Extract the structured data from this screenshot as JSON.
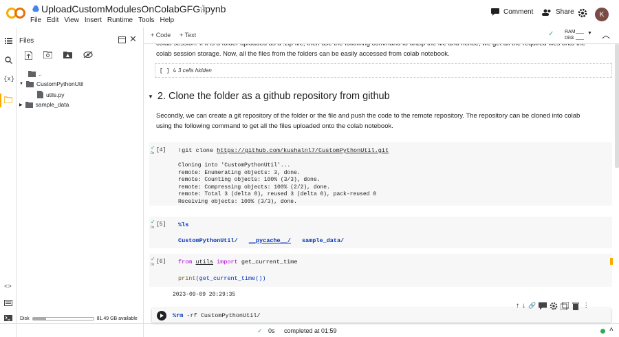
{
  "app": {
    "notebook_title": "UploadCustomModulesOnColabGFG.ipynb",
    "logo_text": "CO",
    "menu": [
      "File",
      "Edit",
      "View",
      "Insert",
      "Runtime",
      "Tools",
      "Help"
    ],
    "comment_label": "Comment",
    "share_label": "Share",
    "avatar_initial": "K",
    "add_code_label": "+ Code",
    "add_text_label": "+ Text",
    "ram_label": "RAM",
    "disk_label": "Disk"
  },
  "sidebar": {
    "files_title": "Files",
    "tree": [
      {
        "name": ".."
      },
      {
        "name": "CustomPythonUtil"
      },
      {
        "name": "utils.py"
      },
      {
        "name": "sample_data"
      }
    ],
    "disk_text": "Disk",
    "disk_available": "81.49 GB available",
    "disk_fraction": 0.22
  },
  "notebook": {
    "intro_text": "colab session. If it is a folder uploaded as a .zip file, then use the following command to unzip the file and hence, we get all the required files onto the colab session storage. Now, all the files from the folders can be easily accessed from colab notebook.",
    "hidden_bracket": "[ ]",
    "hidden_cells_text": "↳ 3 cells hidden",
    "section_title": "2. Clone the folder as a github repository from github",
    "section_text": "Secondly, we can create a git repository of the folder or the file and push the code to the remote repository. The repository can be cloned into colab using the following command to get all the files uploaded onto the colab notebook.",
    "cells": [
      {
        "exec": "[4]",
        "time": "0s",
        "code_prefix": "!git clone ",
        "code_link": "https://github.com/kushalnl7/CustomPythonUtil.git",
        "output": "Cloning into 'CustomPythonUtil'...\nremote: Enumerating objects: 3, done.\nremote: Counting objects: 100% (3/3), done.\nremote: Compressing objects: 100% (2/2), done.\nremote: Total 3 (delta 0), reused 3 (delta 0), pack-reused 0\nReceiving objects: 100% (3/3), done."
      },
      {
        "exec": "[5]",
        "time": "0s",
        "code": "%ls",
        "output_dirs": [
          "CustomPythonUtil/",
          "__pycache__/",
          "sample_data/"
        ]
      },
      {
        "exec": "[6]",
        "time": "0s",
        "code_kw1": "from",
        "code_mod": "utils",
        "code_kw2": "import",
        "code_fn": "get_current_time",
        "code_line2_fn": "print",
        "code_line2_arg": "(get_current_time())",
        "output": "2023-09-09 20:29:35"
      },
      {
        "code_magic": "%rm",
        "code_rest": " -rf CustomPythonUtil/"
      }
    ]
  },
  "status": {
    "time": "0s",
    "completed": "completed at 01:59"
  },
  "colors": {
    "accent_orange": "#f9ab00",
    "check_green": "#34a853",
    "avatar": "#7b4b45"
  }
}
